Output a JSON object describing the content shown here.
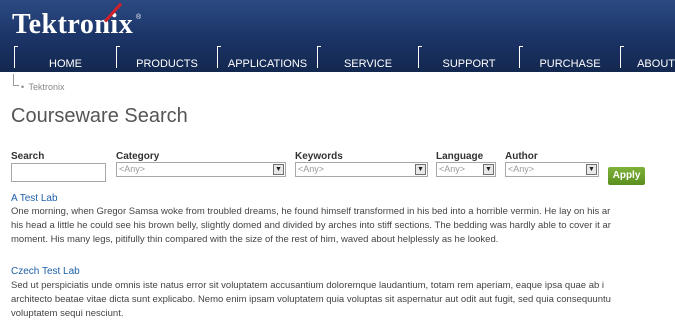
{
  "header": {
    "logo": "Tektronix",
    "logo_reg": "®",
    "nav": [
      "HOME",
      "PRODUCTS",
      "APPLICATIONS",
      "SERVICE",
      "SUPPORT",
      "PURCHASE",
      "ABOUT"
    ]
  },
  "breadcrumb": {
    "bullet": "•",
    "label": "Tektronix"
  },
  "page": {
    "title": "Courseware Search"
  },
  "search_form": {
    "search_label": "Search",
    "search_value": "",
    "category_label": "Category",
    "category_value": "<Any>",
    "keywords_label": "Keywords",
    "keywords_value": "<Any>",
    "language_label": "Language",
    "language_value": "<Any>",
    "author_label": "Author",
    "author_value": "<Any>",
    "apply_label": "Apply",
    "dropdown_arrow": "▼"
  },
  "results": [
    {
      "title": "A Test Lab",
      "lines": [
        "One morning, when Gregor Samsa woke from troubled dreams, he found himself transformed in his bed into a horrible vermin. He lay on his ar",
        "his head a little he could see his brown belly, slightly domed and divided by arches into stiff sections. The bedding was hardly able to cover it ar",
        "moment. His many legs, pitifully thin compared with the size of the rest of him, waved about helplessly as he looked."
      ]
    },
    {
      "title": "Czech Test Lab",
      "lines": [
        "Sed ut perspiciatis unde omnis iste natus error sit voluptatem accusantium doloremque laudantium, totam rem aperiam, eaque ipsa quae ab i",
        "architecto beatae vitae dicta sunt explicabo. Nemo enim ipsam voluptatem quia voluptas sit aspernatur aut odit aut fugit, sed quia consequuntu",
        "voluptatem sequi nesciunt."
      ]
    }
  ],
  "colors": {
    "header_bg": "#1b3366",
    "link": "#1f5fa8",
    "apply": "#6aa12c",
    "logo_accent": "#d0202a"
  }
}
